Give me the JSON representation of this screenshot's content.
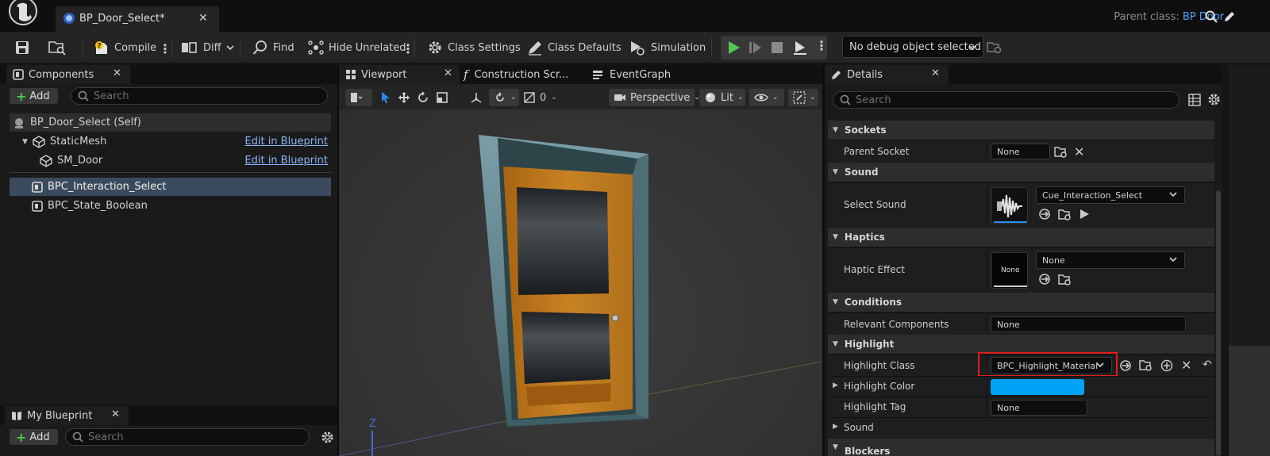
{
  "titlebar": {
    "tab_title": "BP_Door_Select*",
    "parent_label": "Parent class:",
    "parent_value": "BP Door"
  },
  "toolbar": {
    "compile": "Compile",
    "diff": "Diff",
    "find": "Find",
    "hide_unrelated": "Hide Unrelated",
    "class_settings": "Class Settings",
    "class_defaults": "Class Defaults",
    "simulation": "Simulation",
    "debug_object": "No debug object selected"
  },
  "components": {
    "tab": "Components",
    "add": "Add",
    "search_placeholder": "Search",
    "items": [
      {
        "label": "BP_Door_Select (Self)",
        "link": ""
      },
      {
        "label": "StaticMesh",
        "link": "Edit in Blueprint"
      },
      {
        "label": "SM_Door",
        "link": "Edit in Blueprint"
      },
      {
        "label": "BPC_Interaction_Select",
        "link": ""
      },
      {
        "label": "BPC_State_Boolean",
        "link": ""
      }
    ]
  },
  "myblueprint": {
    "tab": "My Blueprint",
    "add": "Add",
    "search_placeholder": "Search"
  },
  "viewport": {
    "tabs": [
      "Viewport",
      "Construction Scr...",
      "EventGraph"
    ],
    "snap_value": "0",
    "perspective": "Perspective",
    "lit": "Lit",
    "axis_z": "Z"
  },
  "details": {
    "tab": "Details",
    "search_placeholder": "Search",
    "sections": {
      "sockets": "Sockets",
      "sound": "Sound",
      "haptics": "Haptics",
      "conditions": "Conditions",
      "highlight": "Highlight",
      "blockers": "Blockers"
    },
    "rows": {
      "parent_socket_label": "Parent Socket",
      "parent_socket_value": "None",
      "select_sound_label": "Select Sound",
      "select_sound_value": "Cue_Interaction_Select",
      "haptic_effect_label": "Haptic Effect",
      "haptic_effect_value": "None",
      "haptic_thumb": "None",
      "relevant_components_label": "Relevant Components",
      "relevant_components_value": "None",
      "highlight_class_label": "Highlight Class",
      "highlight_class_value": "BPC_Highlight_Material",
      "highlight_color_label": "Highlight Color",
      "highlight_color_value": "#00a3f5",
      "highlight_tag_label": "Highlight Tag",
      "highlight_tag_value": "None",
      "sound_sub_label": "Sound"
    }
  },
  "colors": {
    "accent_blue": "#2a8cf0",
    "selection": "#3b4a5c",
    "play_green": "#4ec94e",
    "highlight_box": "#e01e1e",
    "door_wood": "#c07a1c",
    "door_frame": "#6a8a94"
  }
}
